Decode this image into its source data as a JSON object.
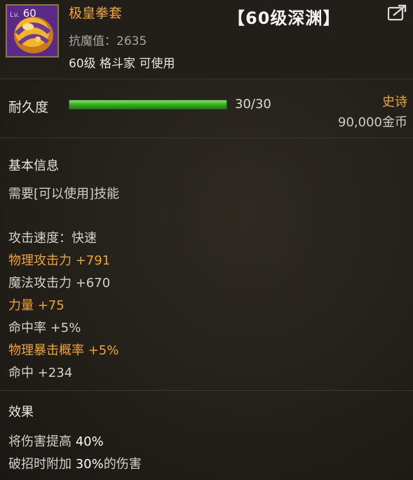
{
  "item": {
    "level_prefix": "Lv.",
    "level": "60",
    "name": "极皇拳套",
    "badge": "【60级深渊】",
    "magic_resist_label": "抗魔值：",
    "magic_resist_value": "2635",
    "requirement": "60级 格斗家 可使用"
  },
  "durability": {
    "label": "耐久度",
    "text": "30/30",
    "fraction": 1.0
  },
  "rarity": "史诗",
  "price": "90,000金币",
  "basic_info": {
    "heading": "基本信息",
    "skill_requirement": "需要[可以使用]技能"
  },
  "stats": [
    {
      "text": "攻击速度：快速",
      "highlight": false
    },
    {
      "text": "物理攻击力 +791",
      "highlight": true
    },
    {
      "text": "魔法攻击力 +670",
      "highlight": false
    },
    {
      "text": "力量 +75",
      "highlight": true
    },
    {
      "text": "命中率 +5%",
      "highlight": false
    },
    {
      "text": "物理暴击概率 +5%",
      "highlight": true
    },
    {
      "text": "命中 +234",
      "highlight": false
    }
  ],
  "effect": {
    "heading": "效果",
    "lines": [
      {
        "prefix": "将伤害提高 ",
        "value": "40%",
        "suffix": ""
      },
      {
        "prefix": "破招时附加 ",
        "value": "30%",
        "suffix": "的伤害"
      }
    ]
  },
  "colors": {
    "epic_orange": "#f0a832",
    "durability_green": "#3cc024",
    "background": "#23201a"
  },
  "icons": {
    "item": "fist-gauntlet-icon",
    "share": "share-icon"
  }
}
